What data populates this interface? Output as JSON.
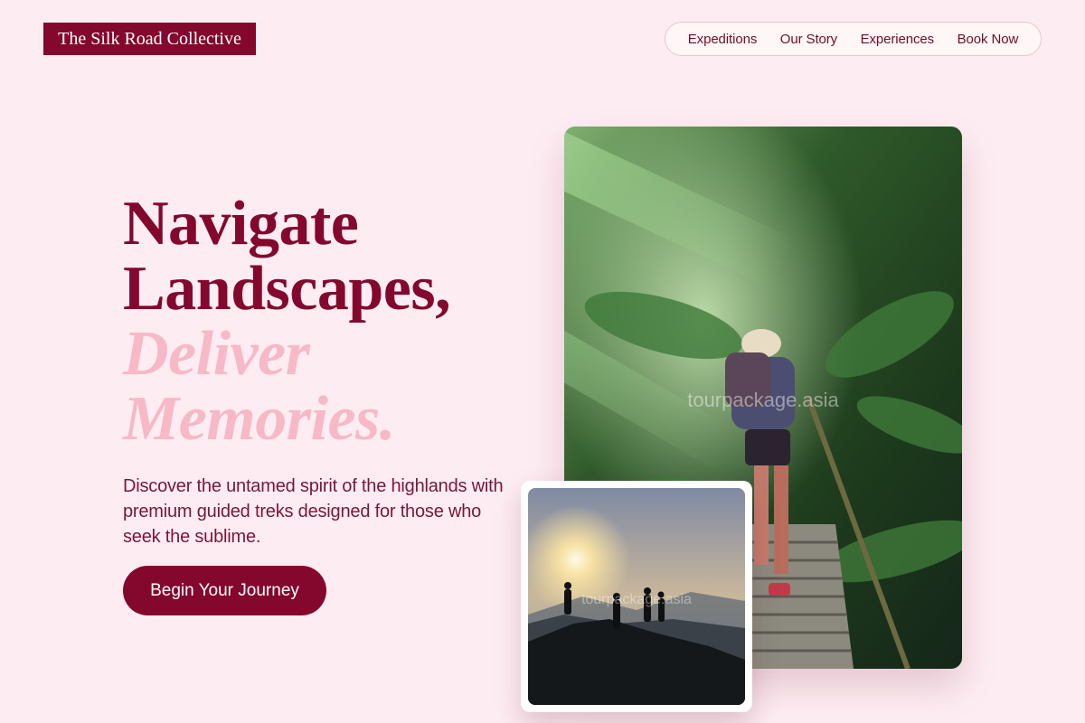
{
  "brand": {
    "name": "The Silk Road Collective"
  },
  "nav": {
    "items": [
      {
        "label": "Expeditions"
      },
      {
        "label": "Our Story"
      },
      {
        "label": "Experiences"
      },
      {
        "label": "Book Now"
      }
    ]
  },
  "hero": {
    "headline_line1": "Navigate",
    "headline_line2": "Landscapes,",
    "headline_line3": "Deliver",
    "headline_line4": "Memories.",
    "description": "Discover the untamed spirit of the highlands with premium guided treks designed for those who seek the sublime.",
    "cta_label": "Begin Your Journey"
  },
  "images": {
    "main": {
      "subject": "hiker-climbing-forest-stairs",
      "watermark": "tourpackage.asia"
    },
    "small": {
      "subject": "hikers-silhouette-sunset-ridge",
      "watermark": "tourpackage.asia"
    }
  },
  "colors": {
    "background": "#fdedf2",
    "brand": "#84072e",
    "accent_light": "#f7b8c8",
    "text": "#7a1636"
  }
}
